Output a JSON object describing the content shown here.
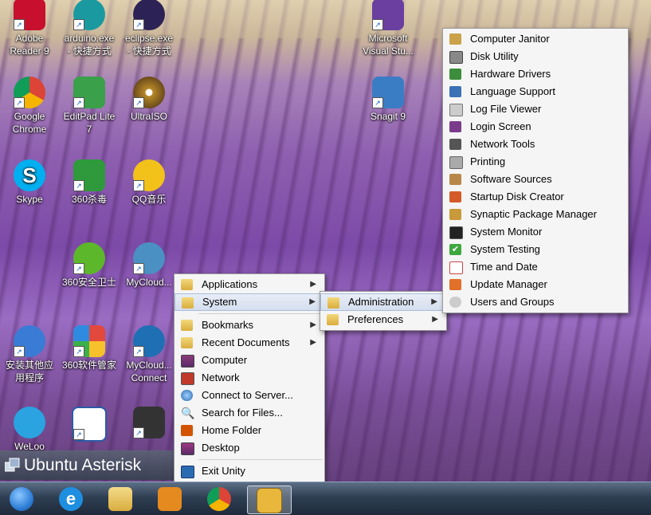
{
  "desktop_icons": [
    {
      "label": "Adobe\nReader 9",
      "icon": "adobe-reader-icon",
      "color": "#c8102e"
    },
    {
      "label": "arduino.exe\n- 快捷方式",
      "icon": "arduino-icon",
      "color": "#1a9aa0"
    },
    {
      "label": "eclipse.exe\n- 快捷方式",
      "icon": "eclipse-icon",
      "color": "#2c2255"
    },
    {
      "label": "Microsoft\nVisual Stu...",
      "icon": "visual-studio-icon",
      "color": "#6a3fa0"
    },
    {
      "label": "Google\nChrome",
      "icon": "chrome-icon",
      "color": "#db4437"
    },
    {
      "label": "EditPad Lite\n7",
      "icon": "editpad-icon",
      "color": "#3aa04a"
    },
    {
      "label": "UltraISO",
      "icon": "ultraiso-icon",
      "color": "#b88a2a"
    },
    {
      "label": "Snagit 9",
      "icon": "snagit-icon",
      "color": "#3b7dc4"
    },
    {
      "label": "Skype",
      "icon": "skype-icon",
      "color": "#00aff0"
    },
    {
      "label": "360杀毒",
      "icon": "360-antivirus-icon",
      "color": "#2e9a3b"
    },
    {
      "label": "QQ音乐",
      "icon": "qq-music-icon",
      "color": "#f2c21b"
    },
    {
      "label": "360安全卫士",
      "icon": "360-security-icon",
      "color": "#5cb82a"
    },
    {
      "label": "MyCloud...",
      "icon": "mycloud-icon",
      "color": "#4a90c2"
    },
    {
      "label": "安装其他应\n用程序",
      "icon": "install-apps-icon",
      "color": "#3a7bd5"
    },
    {
      "label": "360软件管家",
      "icon": "360-software-icon",
      "color": "#e2483c"
    },
    {
      "label": "MyCloud...\nConnect",
      "icon": "mycloud-connect-icon",
      "color": "#1f6fb5"
    },
    {
      "label": "WeLoo",
      "icon": "weloo-icon",
      "color": "#2aa3e0"
    },
    {
      "label": "",
      "icon": "word-document-icon",
      "color": "#2b5aa8"
    },
    {
      "label": "",
      "icon": "openvpn-icon",
      "color": "#333333"
    }
  ],
  "main_menu": {
    "items": [
      {
        "label": "Applications",
        "has_sub": true,
        "icon": "folder-icon"
      },
      {
        "label": "System",
        "has_sub": true,
        "icon": "folder-icon",
        "highlighted": true
      },
      {
        "label": "Bookmarks",
        "has_sub": true,
        "icon": "folder-icon"
      },
      {
        "label": "Recent Documents",
        "has_sub": true,
        "icon": "folder-icon"
      },
      {
        "label": "Computer",
        "icon": "computer-icon"
      },
      {
        "label": "Network",
        "icon": "network-icon"
      },
      {
        "label": "Connect to Server...",
        "icon": "globe-icon"
      },
      {
        "label": "Search for Files...",
        "icon": "magnifier-icon"
      },
      {
        "label": "Home Folder",
        "icon": "home-folder-icon"
      },
      {
        "label": "Desktop",
        "icon": "desktop-icon"
      },
      {
        "label": "Exit Unity",
        "icon": "exit-icon"
      }
    ]
  },
  "system_menu": {
    "items": [
      {
        "label": "Administration",
        "has_sub": true,
        "highlighted": true
      },
      {
        "label": "Preferences",
        "has_sub": true
      }
    ]
  },
  "admin_menu": {
    "items": [
      {
        "label": "Computer Janitor",
        "icon": "broom-icon"
      },
      {
        "label": "Disk Utility",
        "icon": "disk-icon"
      },
      {
        "label": "Hardware Drivers",
        "icon": "chip-icon"
      },
      {
        "label": "Language Support",
        "icon": "language-icon"
      },
      {
        "label": "Log File Viewer",
        "icon": "log-viewer-icon"
      },
      {
        "label": "Login Screen",
        "icon": "login-screen-icon"
      },
      {
        "label": "Network Tools",
        "icon": "network-tools-icon"
      },
      {
        "label": "Printing",
        "icon": "printer-icon"
      },
      {
        "label": "Software Sources",
        "icon": "software-sources-icon"
      },
      {
        "label": "Startup Disk Creator",
        "icon": "startup-disk-icon"
      },
      {
        "label": "Synaptic Package Manager",
        "icon": "package-icon"
      },
      {
        "label": "System Monitor",
        "icon": "system-monitor-icon"
      },
      {
        "label": "System Testing",
        "icon": "checkmark-icon"
      },
      {
        "label": "Time and Date",
        "icon": "clock-icon"
      },
      {
        "label": "Update Manager",
        "icon": "update-icon"
      },
      {
        "label": "Users and Groups",
        "icon": "users-icon"
      }
    ]
  },
  "unity_bar": {
    "title": "Ubuntu Asterisk"
  },
  "taskbar": {
    "items": [
      {
        "name": "start-button",
        "icon": "windows-logo-icon",
        "color": "#2f7fd8"
      },
      {
        "name": "internet-explorer",
        "icon": "ie-icon",
        "color": "#1e8fe0"
      },
      {
        "name": "file-explorer",
        "icon": "folder-icon",
        "color": "#e7c45a"
      },
      {
        "name": "media-player",
        "icon": "media-player-icon",
        "color": "#e48a1f"
      },
      {
        "name": "chrome",
        "icon": "chrome-icon",
        "color": "#db4437"
      },
      {
        "name": "ubuntu-asterisk",
        "icon": "asterisk-icon",
        "color": "#e8b73c",
        "active": true
      }
    ]
  }
}
